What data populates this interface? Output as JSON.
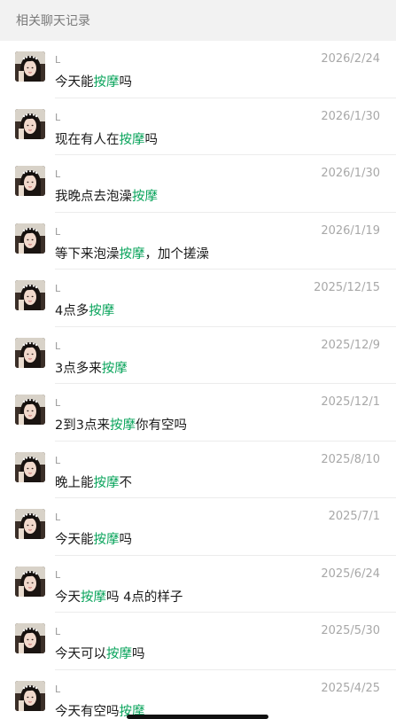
{
  "header": {
    "title": "相关聊天记录"
  },
  "results": [
    {
      "name": "L",
      "date": "2026/2/24",
      "before": "今天能",
      "keyword": "按摩",
      "after": "吗"
    },
    {
      "name": "L",
      "date": "2026/1/30",
      "before": "现在有人在",
      "keyword": "按摩",
      "after": "吗"
    },
    {
      "name": "L",
      "date": "2026/1/30",
      "before": "我晚点去泡澡",
      "keyword": "按摩",
      "after": ""
    },
    {
      "name": "L",
      "date": "2026/1/19",
      "before": "等下来泡澡",
      "keyword": "按摩",
      "after": "，加个搓澡"
    },
    {
      "name": "L",
      "date": "2025/12/15",
      "before": "4点多",
      "keyword": "按摩",
      "after": ""
    },
    {
      "name": "L",
      "date": "2025/12/9",
      "before": "3点多来",
      "keyword": "按摩",
      "after": ""
    },
    {
      "name": "L",
      "date": "2025/12/1",
      "before": "2到3点来",
      "keyword": "按摩",
      "after": "你有空吗"
    },
    {
      "name": "L",
      "date": "2025/8/10",
      "before": "晚上能",
      "keyword": "按摩",
      "after": "不"
    },
    {
      "name": "L",
      "date": "2025/7/1",
      "before": "今天能",
      "keyword": "按摩",
      "after": "吗"
    },
    {
      "name": "L",
      "date": "2025/6/24",
      "before": "今天",
      "keyword": "按摩",
      "after": "吗 4点的样子"
    },
    {
      "name": "L",
      "date": "2025/5/30",
      "before": "今天可以",
      "keyword": "按摩",
      "after": "吗"
    },
    {
      "name": "L",
      "date": "2025/4/25",
      "before": "今天有空吗",
      "keyword": "按摩",
      "after": ""
    }
  ]
}
